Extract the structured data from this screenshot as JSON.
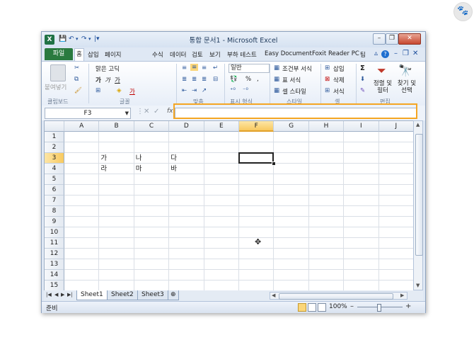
{
  "watermark": "🐾",
  "window": {
    "title": "통합 문서1 - Microsoft Excel",
    "app_icon": "X",
    "quick_access": [
      "save-icon",
      "undo-icon",
      "redo-icon",
      "customize-icon"
    ],
    "controls": {
      "minimize": "–",
      "restore": "❐",
      "close": "✕"
    }
  },
  "tabs": {
    "file": "파일",
    "items": [
      "홈",
      "삽입",
      "페이지",
      "수식",
      "데이터",
      "검토",
      "보기",
      "부하 테스트",
      "Easy Document",
      "Foxit Reader PC",
      "팀"
    ],
    "right_icons": [
      "▵",
      "?",
      "–",
      "❐",
      "✕"
    ]
  },
  "ribbon": {
    "clipboard": {
      "paste": "붙여넣기",
      "label": "클립보드"
    },
    "font": {
      "name": "맑은 고딕",
      "bold": "가",
      "italic": "가",
      "underline": "가",
      "sample": "가",
      "label": "글꼴"
    },
    "alignment": {
      "label": "맞춤"
    },
    "number": {
      "format": "일반",
      "percent": "%",
      "comma": ",",
      "label": "표시 형식"
    },
    "styles": {
      "conditional": "조건부 서식",
      "table": "표 서식",
      "cell": "셀 스타일",
      "label": "스타일"
    },
    "cells": {
      "insert": "삽입",
      "delete": "삭제",
      "format": "서식",
      "label": "셀"
    },
    "editing": {
      "sigma": "Σ",
      "sort": "정렬 및 필터",
      "find": "찾기 및 선택",
      "label": "편집"
    }
  },
  "formula_bar": {
    "name_box": "F3",
    "fx": "fx",
    "value": ""
  },
  "columns": [
    "A",
    "B",
    "C",
    "D",
    "E",
    "F",
    "G",
    "H",
    "I",
    "J"
  ],
  "rows": [
    "1",
    "2",
    "3",
    "4",
    "5",
    "6",
    "7",
    "8",
    "9",
    "10",
    "11",
    "12",
    "13",
    "14",
    "15"
  ],
  "cells": {
    "B3": "가",
    "C3": "나",
    "D3": "다",
    "B4": "라",
    "C4": "마",
    "D4": "바"
  },
  "selection": {
    "cell": "F3",
    "column": "F",
    "row": "3"
  },
  "sheets": {
    "tabs": [
      "Sheet1",
      "Sheet2",
      "Sheet3"
    ],
    "active": "Sheet1"
  },
  "status": {
    "mode": "준비",
    "zoom": "100%",
    "minus": "–",
    "plus": "+"
  },
  "annotation": {
    "color": "#f5a623"
  }
}
